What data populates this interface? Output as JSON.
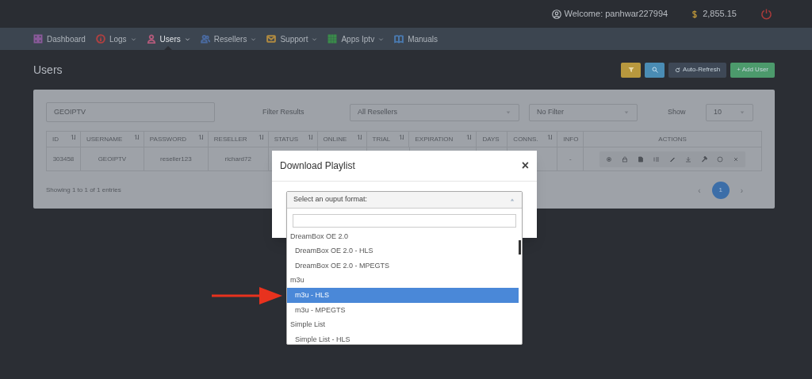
{
  "header": {
    "welcome": "Welcome: panhwar227994",
    "balance": "2,855.15"
  },
  "nav": [
    {
      "label": "Dashboard",
      "color": "#8a5a9a",
      "caret": false,
      "selected": false
    },
    {
      "label": "Logs",
      "color": "#b04040",
      "caret": true,
      "selected": false
    },
    {
      "label": "Users",
      "color": "#b05a7a",
      "caret": true,
      "selected": true
    },
    {
      "label": "Resellers",
      "color": "#4a6aa0",
      "caret": true,
      "selected": false
    },
    {
      "label": "Support",
      "color": "#b08a40",
      "caret": true,
      "selected": false
    },
    {
      "label": "Apps Iptv",
      "color": "#3a8a4a",
      "caret": true,
      "selected": false
    },
    {
      "label": "Manuals",
      "color": "#4a7ab0",
      "caret": false,
      "selected": false
    }
  ],
  "page_title": "Users",
  "toolbar": [
    {
      "kind": "filter"
    },
    {
      "kind": "search"
    },
    {
      "kind": "refresh",
      "label": "Auto-Refresh"
    },
    {
      "kind": "add",
      "label": "+ Add User"
    }
  ],
  "filters": {
    "search_value": "GEOIPTV",
    "filter_label": "Filter Results",
    "reseller": "All Resellers",
    "status": "No Filter",
    "show_label": "Show",
    "show_value": "10"
  },
  "table": {
    "columns": [
      "ID",
      "USERNAME",
      "PASSWORD",
      "RESELLER",
      "STATUS",
      "ONLINE",
      "TRIAL",
      "EXPIRATION",
      "DAYS",
      "CONNS.",
      "INFO",
      "ACTIONS"
    ],
    "sortable": [
      true,
      true,
      true,
      true,
      true,
      true,
      true,
      true,
      false,
      true,
      false,
      false
    ],
    "rows": [
      {
        "id": "303458",
        "username": "GEOIPTV",
        "password": "reseller123",
        "reseller": "richard72",
        "info": "-"
      }
    ]
  },
  "entries_info": "Showing 1 to 1 of 1 entries",
  "pagination": {
    "prev": "‹",
    "page": "1",
    "next": "›"
  },
  "modal": {
    "title": "Download Playlist",
    "close": "×",
    "select_placeholder": "Select an ouput format:",
    "options": [
      {
        "kind": "group",
        "label": "DreamBox OE 2.0",
        "selected": false
      },
      {
        "kind": "option",
        "label": "DreamBox OE 2.0 - HLS",
        "selected": false
      },
      {
        "kind": "option",
        "label": "DreamBox OE 2.0 - MPEGTS",
        "selected": false
      },
      {
        "kind": "group",
        "label": "m3u",
        "selected": false
      },
      {
        "kind": "option",
        "label": "m3u - HLS",
        "selected": true
      },
      {
        "kind": "option",
        "label": "m3u - MPEGTS",
        "selected": false
      },
      {
        "kind": "group",
        "label": "Simple List",
        "selected": false
      },
      {
        "kind": "option",
        "label": "Simple List - HLS",
        "selected": false
      }
    ]
  }
}
